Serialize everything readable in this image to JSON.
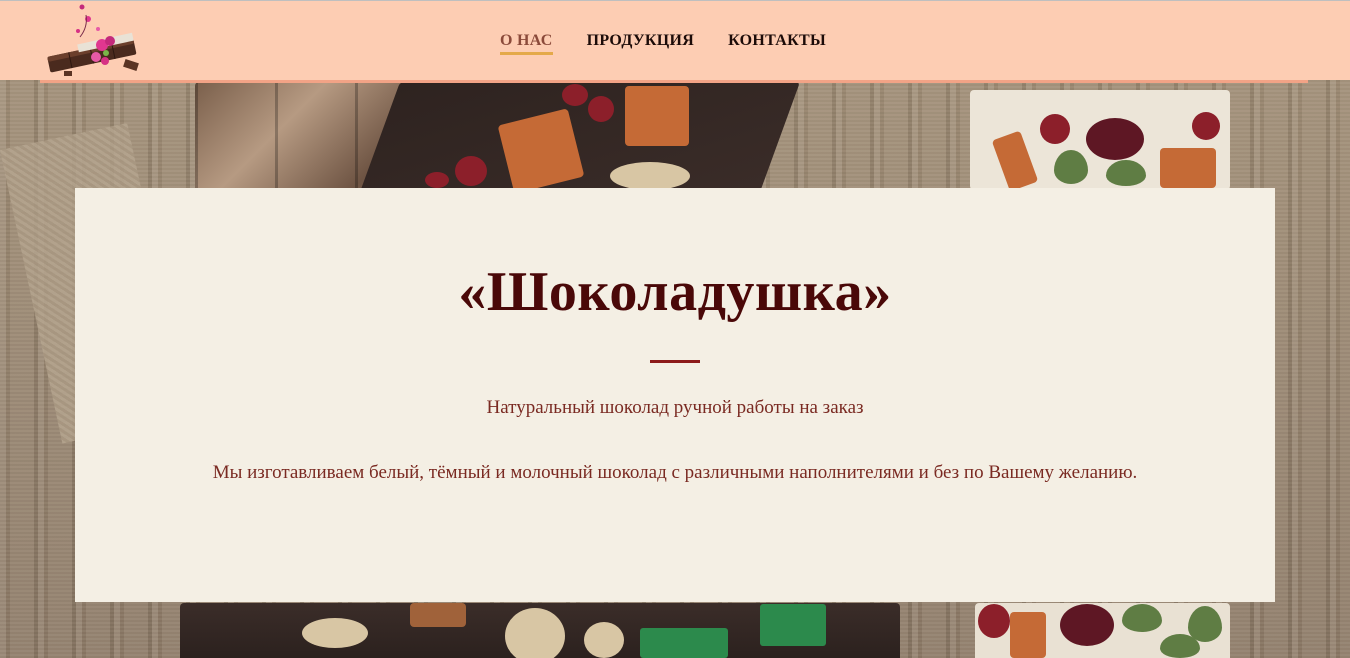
{
  "nav": {
    "items": [
      {
        "label": "О НАС",
        "active": true
      },
      {
        "label": "ПРОДУКЦИЯ",
        "active": false
      },
      {
        "label": "КОНТАКТЫ",
        "active": false
      }
    ]
  },
  "hero": {
    "title": "«Шоколадушка»",
    "subtitle": "Натуральный шоколад ручной работы на заказ",
    "text": "Мы изготавливаем белый, тёмный и молочный шоколад с различными наполнителями и без по Вашему желанию."
  },
  "colors": {
    "header_bg": "#fdcdb3",
    "header_line": "#f2a386",
    "card_bg": "#f4efe4",
    "title": "#4a0808",
    "body_text": "#7a2a22",
    "active_underline": "#e4a94a",
    "divider": "#8c1a1a"
  },
  "icons": {
    "logo": "chocolate-bar-with-flowers-logo"
  }
}
